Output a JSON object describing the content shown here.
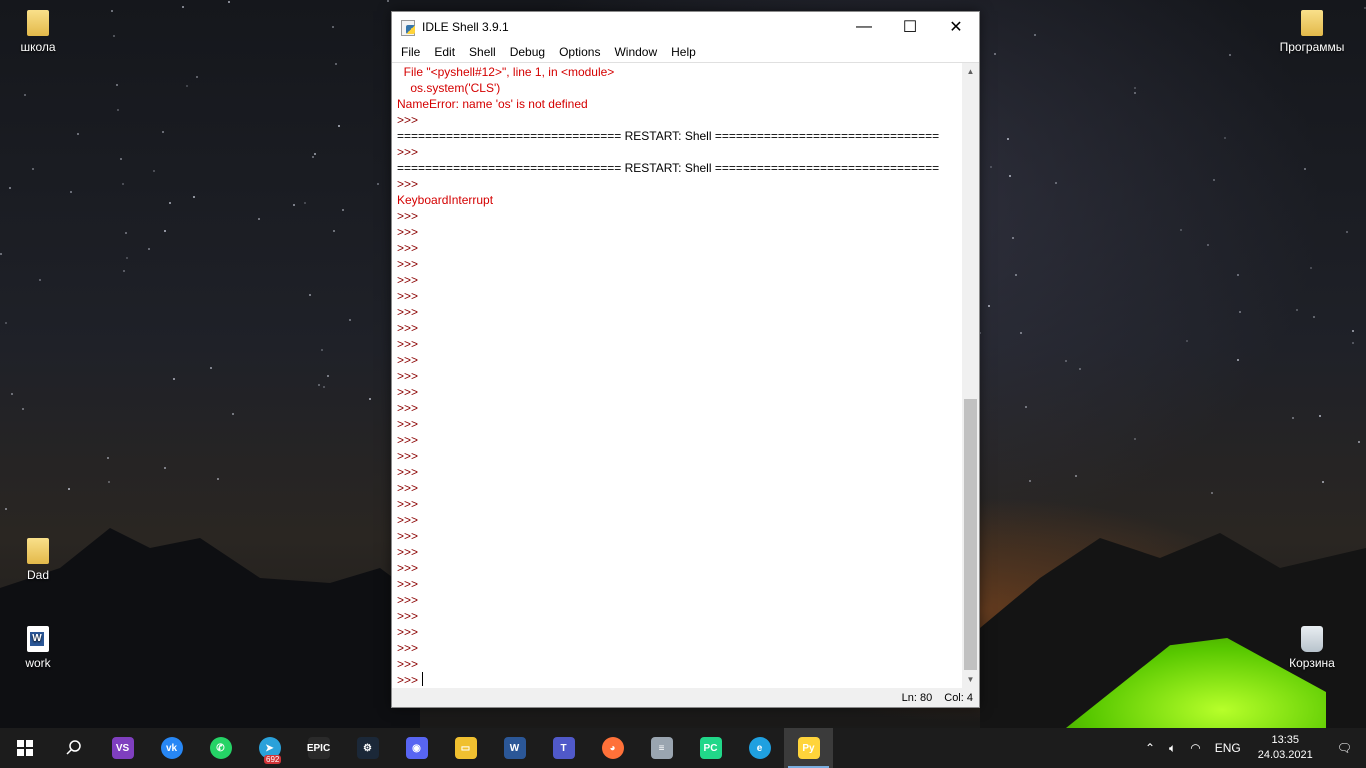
{
  "desktop": {
    "icons": [
      {
        "label": "школа"
      },
      {
        "label": "Dad"
      },
      {
        "label": "work"
      },
      {
        "label": "Программы"
      },
      {
        "label": "Корзина"
      }
    ]
  },
  "window": {
    "title": "IDLE Shell 3.9.1",
    "controls": {
      "minimize": "—",
      "maximize": "☐",
      "close": "✕"
    },
    "menu": [
      "File",
      "Edit",
      "Shell",
      "Debug",
      "Options",
      "Window",
      "Help"
    ],
    "lines": [
      {
        "text": "  File \"<pyshell#12>\", line 1, in <module>",
        "kind": "err"
      },
      {
        "text": "    os.system('CLS')",
        "kind": "err"
      },
      {
        "text": "NameError: name 'os' is not defined",
        "kind": "err"
      },
      {
        "text": ">>> ",
        "kind": "prompt"
      },
      {
        "text": "================================ RESTART: Shell ================================",
        "kind": "plain"
      },
      {
        "text": ">>> ",
        "kind": "prompt"
      },
      {
        "text": "================================ RESTART: Shell ================================",
        "kind": "plain"
      },
      {
        "text": ">>> ",
        "kind": "prompt"
      },
      {
        "text": "KeyboardInterrupt",
        "kind": "err"
      },
      {
        "text": ">>> ",
        "kind": "prompt"
      },
      {
        "text": ">>> ",
        "kind": "prompt"
      },
      {
        "text": ">>> ",
        "kind": "prompt"
      },
      {
        "text": ">>> ",
        "kind": "prompt"
      },
      {
        "text": ">>> ",
        "kind": "prompt"
      },
      {
        "text": ">>> ",
        "kind": "prompt"
      },
      {
        "text": ">>> ",
        "kind": "prompt"
      },
      {
        "text": ">>> ",
        "kind": "prompt"
      },
      {
        "text": ">>> ",
        "kind": "prompt"
      },
      {
        "text": ">>> ",
        "kind": "prompt"
      },
      {
        "text": ">>> ",
        "kind": "prompt"
      },
      {
        "text": ">>> ",
        "kind": "prompt"
      },
      {
        "text": ">>> ",
        "kind": "prompt"
      },
      {
        "text": ">>> ",
        "kind": "prompt"
      },
      {
        "text": ">>> ",
        "kind": "prompt"
      },
      {
        "text": ">>> ",
        "kind": "prompt"
      },
      {
        "text": ">>> ",
        "kind": "prompt"
      },
      {
        "text": ">>> ",
        "kind": "prompt"
      },
      {
        "text": ">>> ",
        "kind": "prompt"
      },
      {
        "text": ">>> ",
        "kind": "prompt"
      },
      {
        "text": ">>> ",
        "kind": "prompt"
      },
      {
        "text": ">>> ",
        "kind": "prompt"
      },
      {
        "text": ">>> ",
        "kind": "prompt"
      },
      {
        "text": ">>> ",
        "kind": "prompt"
      },
      {
        "text": ">>> ",
        "kind": "prompt"
      },
      {
        "text": ">>> ",
        "kind": "prompt"
      },
      {
        "text": ">>> ",
        "kind": "prompt"
      },
      {
        "text": ">>> ",
        "kind": "prompt"
      },
      {
        "text": ">>> ",
        "kind": "prompt"
      },
      {
        "text": ">>> ",
        "kind": "prompt"
      }
    ],
    "status": {
      "ln": "Ln: 80",
      "col": "Col: 4"
    }
  },
  "taskbar": {
    "apps": [
      {
        "name": "visual-studio",
        "color": "#7f3fbf",
        "glyph": "VS"
      },
      {
        "name": "vk",
        "color": "#2787f5",
        "glyph": "vk"
      },
      {
        "name": "whatsapp",
        "color": "#25d366",
        "glyph": "✆"
      },
      {
        "name": "telegram",
        "color": "#2aa1da",
        "glyph": "➤"
      },
      {
        "name": "epic-games",
        "color": "#2a2a2a",
        "glyph": "EPIC"
      },
      {
        "name": "steam",
        "color": "#1b2838",
        "glyph": "⚙"
      },
      {
        "name": "discord",
        "color": "#5865f2",
        "glyph": "◉"
      },
      {
        "name": "file-explorer",
        "color": "#f0c030",
        "glyph": "▭"
      },
      {
        "name": "word",
        "color": "#2b5797",
        "glyph": "W"
      },
      {
        "name": "teams",
        "color": "#5059c9",
        "glyph": "T"
      },
      {
        "name": "firefox",
        "color": "#ff7139",
        "glyph": "◕"
      },
      {
        "name": "database",
        "color": "#9aa5b0",
        "glyph": "≡"
      },
      {
        "name": "pycharm",
        "color": "#21d789",
        "glyph": "PC"
      },
      {
        "name": "edge",
        "color": "#1fa0e0",
        "glyph": "e"
      },
      {
        "name": "idle",
        "color": "#ffd43b",
        "glyph": "Py"
      }
    ],
    "telegram_badge": "692",
    "language": "ENG",
    "time": "13:35",
    "date": "24.03.2021"
  }
}
